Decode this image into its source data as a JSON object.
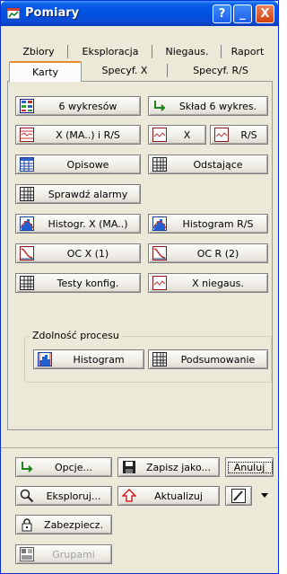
{
  "window": {
    "title": "Pomiary"
  },
  "titlebar_buttons": {
    "help": "?",
    "minimize": "_",
    "close": "X"
  },
  "tabs_row1": [
    "Zbiory",
    "Eksploracja",
    "Niegaus.",
    "Raport"
  ],
  "tabs_row2": [
    "Karty",
    "Specyf. X",
    "Specyf. R/S"
  ],
  "active_tab": "Karty",
  "buttons": {
    "six_charts": "6 wykresów",
    "six_composition": "Skład 6 wykres.",
    "x_ma_rs": "X (MA..) i R/S",
    "x": "X",
    "rs": "R/S",
    "descriptive": "Opisowe",
    "outliers": "Odstające",
    "check_alarms": "Sprawdź alarmy",
    "histogram_x_ma": "Histogr. X (MA..)",
    "histogram_rs": "Histogram R/S",
    "oc_x1": "OC X (1)",
    "oc_r2": "OC R (2)",
    "config_tests": "Testy konfig.",
    "x_nongaussian": "X niegaus."
  },
  "capability_group": {
    "title": "Zdolność procesu",
    "histogram": "Histogram",
    "summary": "Podsumowanie"
  },
  "footer": {
    "options": "Opcje...",
    "save_as": "Zapisz jako...",
    "cancel": "Anuluj",
    "explore": "Eksploruj...",
    "update": "Aktualizuj",
    "protect": "Zabezpiecz.",
    "groups": "Grupami"
  },
  "colors": {
    "titlebar": "#0054e3",
    "active_tab_accent": "#e68b2c",
    "face": "#ece9d8"
  },
  "icons": {
    "app": "chart-window-icon",
    "six_charts": "six-charts-icon",
    "six_composition": "composition-arrow-icon",
    "x_ma_rs": "control-chart-icon",
    "x": "line-chart-icon",
    "rs": "line-chart-icon",
    "descriptive": "summary-table-icon",
    "outliers": "grid-table-icon",
    "check_alarms": "grid-table-icon",
    "histogram": "histogram-icon",
    "oc_curve": "oc-curve-icon",
    "config_tests": "grid-table-icon",
    "options": "green-arrow-icon",
    "save_as": "floppy-disk-icon",
    "explore": "magnifier-icon",
    "update": "red-arrow-up-icon",
    "graph_menu": "graph-brush-icon",
    "protect": "padlock-icon",
    "groups": "groups-icon"
  }
}
